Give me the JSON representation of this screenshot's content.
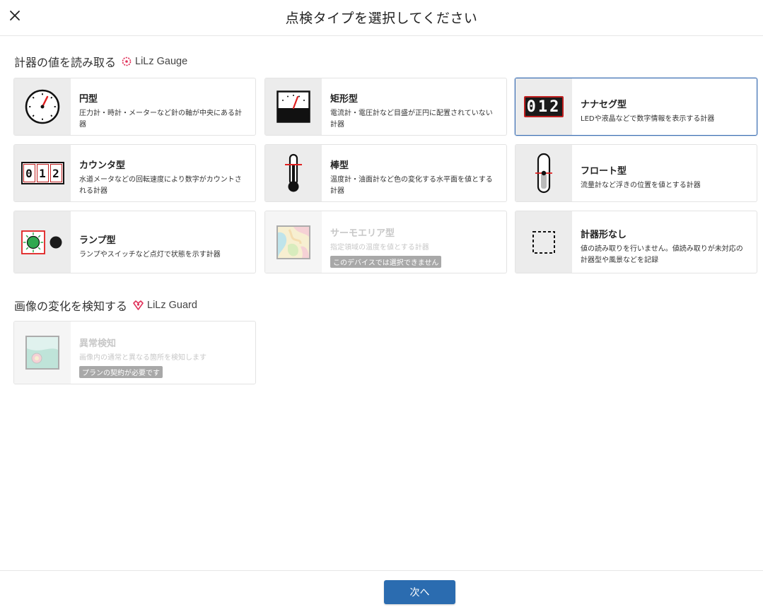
{
  "header": {
    "title": "点検タイプを選択してください"
  },
  "sections": [
    {
      "title": "計器の値を読み取る",
      "brand": "LiLz Gauge"
    },
    {
      "title": "画像の変化を検知する",
      "brand": "LiLz Guard"
    }
  ],
  "cards": [
    {
      "title": "円型",
      "desc": "圧力計・時計・メーターなど針の軸が中央にある計器",
      "icon": "round-gauge-icon"
    },
    {
      "title": "矩形型",
      "desc": "電流計・電圧計など目盛が正円に配置されていない計器",
      "icon": "rectangular-meter-icon"
    },
    {
      "title": "ナナセグ型",
      "desc": "LEDや液晶などで数字情報を表示する計器",
      "icon": "seven-segment-icon",
      "digits": "012",
      "selected": true
    },
    {
      "title": "カウンタ型",
      "desc": "水道メータなどの回転速度により数字がカウントされる計器",
      "icon": "counter-icon",
      "digits": [
        "0",
        "1",
        "2"
      ]
    },
    {
      "title": "棒型",
      "desc": "温度計・油面計など色の変化する水平面を値とする計器",
      "icon": "thermometer-icon"
    },
    {
      "title": "フロート型",
      "desc": "流量計など浮きの位置を値とする計器",
      "icon": "float-meter-icon"
    },
    {
      "title": "ランプ型",
      "desc": "ランプやスイッチなど点灯で状態を示す計器",
      "icon": "lamp-icon"
    },
    {
      "title": "サーモエリア型",
      "desc": "指定領域の温度を値とする計器",
      "icon": "thermo-area-icon",
      "badge": "このデバイスでは選択できません",
      "disabled": true
    },
    {
      "title": "計器形なし",
      "desc": "値の読み取りを行いません。値読み取りが未対応の計器型や風景などを記録",
      "icon": "no-gauge-icon"
    },
    {
      "title": "異常検知",
      "desc": "画像内の通常と異なる箇所を検知します",
      "icon": "anomaly-detection-icon",
      "badge": "プランの契約が必要です",
      "disabled": true
    }
  ],
  "footer": {
    "next_label": "次へ"
  },
  "colors": {
    "accent": "#2b6cb0",
    "selected_border": "#3d6fb3",
    "brand_red": "#e0325a",
    "disabled_badge": "#a8a8a8"
  }
}
